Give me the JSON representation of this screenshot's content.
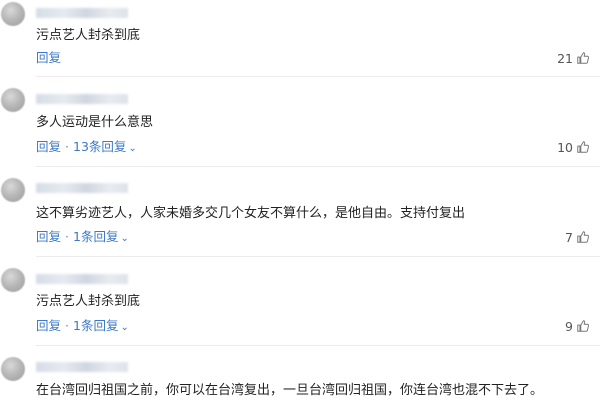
{
  "comments": [
    {
      "text": "污点艺人封杀到底",
      "reply_label": "回复",
      "replies": "",
      "likes": "21"
    },
    {
      "text": "多人运动是什么意思",
      "reply_label": "回复",
      "replies": "13条回复",
      "likes": "10"
    },
    {
      "text": "这不算劣迹艺人，人家未婚多交几个女友不算什么，是他自由。支持付复出",
      "reply_label": "回复",
      "replies": "1条回复",
      "likes": "7"
    },
    {
      "text": "污点艺人封杀到底",
      "reply_label": "回复",
      "replies": "1条回复",
      "likes": "9"
    },
    {
      "text": "在台湾回归祖国之前，你可以在台湾复出，一旦台湾回归祖国，你连台湾也混不下去了。"
    }
  ],
  "colors": {
    "link": "#3b78c8",
    "text": "#222222",
    "muted": "#555555"
  },
  "icons": {
    "like": "thumbs-up-icon",
    "expand": "chevron-down-icon"
  }
}
